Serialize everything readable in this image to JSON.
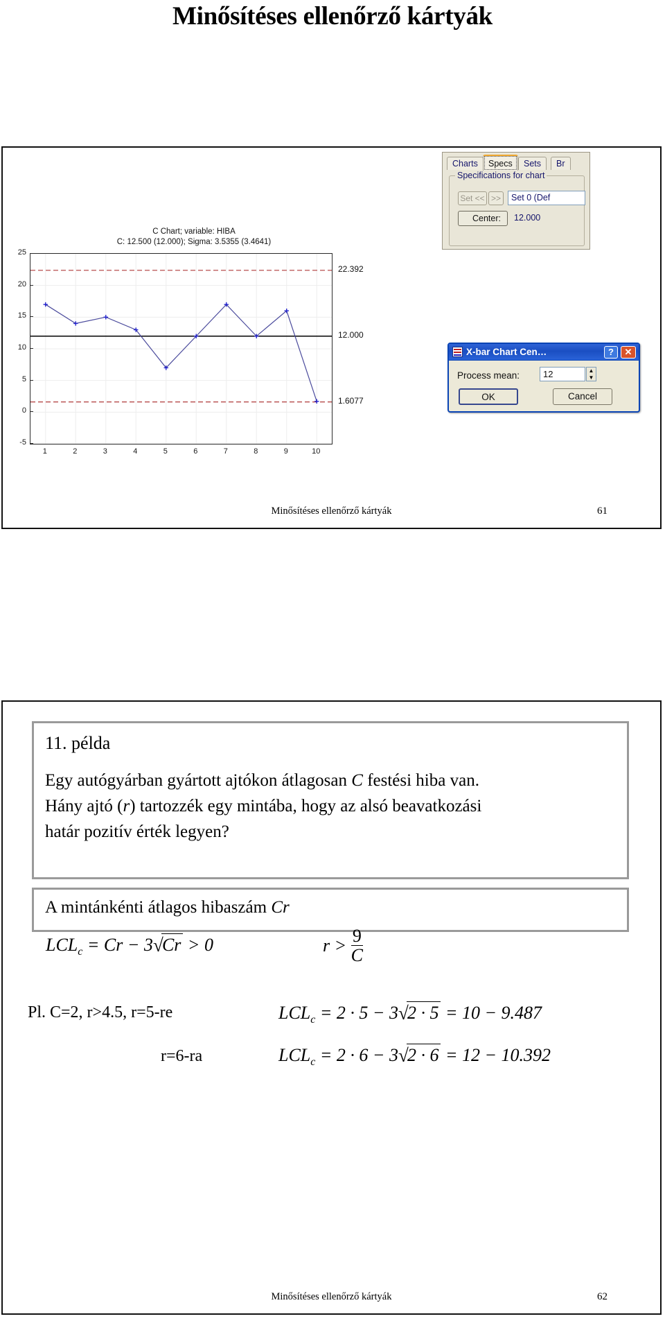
{
  "doc": {
    "title": "Minősítéses ellenőrző kártyák"
  },
  "slide61": {
    "footer_title": "Minősítéses ellenőrző kártyák",
    "page_number": "61",
    "chart": {
      "title": "C Chart; variable:  HIBA",
      "subtitle": "C: 12.500 (12.000); Sigma: 3.5355 (3.4641)",
      "ucl_label": "22.392",
      "cl_label": "12.000",
      "lcl_label": "1.6077"
    },
    "specs_panel": {
      "tabs": [
        "Charts",
        "Specs",
        "Sets",
        "Br"
      ],
      "active_tab": "Specs",
      "group_title": "Specifications for chart",
      "set_prev_label": "Set <<",
      "set_next_label": ">>",
      "set_combo_value": "Set 0 (Def",
      "center_button_label": "Center:",
      "center_icon": "center-arrow-icon",
      "center_value": "12.000"
    },
    "xbar_dialog": {
      "title": "X-bar Chart Cen…",
      "icon": "chart-window-icon",
      "help_label": "?",
      "close_label": "✕",
      "mean_label": "Process mean:",
      "mean_value": "12",
      "spin_up": "▲",
      "spin_down": "▼",
      "ok_label": "OK",
      "cancel_label": "Cancel"
    }
  },
  "slide62": {
    "footer_title": "Minősítéses ellenőrző kártyák",
    "page_number": "62",
    "example_heading": "11. példa",
    "example_line1_a": "Egy autógyárban gyártott ajtókon átlagosan ",
    "example_line1_c": "C",
    "example_line1_b": " festési hiba van.",
    "example_line2_a": "Hány ajtó (",
    "example_line2_r": "r",
    "example_line2_b": ") tartozzék egy mintába, hogy az alsó beavatkozási",
    "example_line3": "határ pozitív érték legyen?",
    "mean_text_a": "A mintánkénti átlagos hibaszám ",
    "mean_text_cr": "Cr",
    "formulas": {
      "lcl1_lhs": "LCL",
      "lcl1_sub": "c",
      "lcl1_mid": " = Cr − 3",
      "lcl1_radicand": "Cr",
      "lcl1_tail": " > 0",
      "r_gt": "r > ",
      "r_num": "9",
      "r_den": "C",
      "pl_label": "Pl. C=2, r>4.5, r=5-re",
      "lcl2_lhs": "LCL",
      "lcl2_sub": "c",
      "lcl2_mid": " = 2 · 5 − 3",
      "lcl2_radicand": "2 · 5",
      "lcl2_tail": " = 10 − 9.487",
      "r6_label": "r=6-ra",
      "lcl3_lhs": "LCL",
      "lcl3_sub": "c",
      "lcl3_mid": " = 2 · 6 − 3",
      "lcl3_radicand": "2 · 6",
      "lcl3_tail": " = 12 − 10.392"
    }
  },
  "chart_data": {
    "type": "line",
    "title": "C Chart; variable:  HIBA",
    "subtitle": "C: 12.500 (12.000); Sigma: 3.5355 (3.4641)",
    "xlabel": "",
    "ylabel": "",
    "x": [
      1,
      2,
      3,
      4,
      5,
      6,
      7,
      8,
      9,
      10
    ],
    "values": [
      17,
      14,
      15,
      13,
      7,
      12,
      17,
      12,
      16,
      1.7
    ],
    "xticks": [
      "1",
      "2",
      "3",
      "4",
      "5",
      "6",
      "7",
      "8",
      "9",
      "10"
    ],
    "yticks": [
      "-5",
      "0",
      "5",
      "10",
      "15",
      "20",
      "25"
    ],
    "ylim": [
      -5,
      25
    ],
    "xlim": [
      0.5,
      10.5
    ],
    "grid": true,
    "legend": null,
    "lines": [
      {
        "name": "UCL",
        "value": 22.392,
        "label": "22.392",
        "style": "dashed",
        "color": "#b03a3a"
      },
      {
        "name": "CL",
        "value": 12.0,
        "label": "12.000",
        "style": "solid",
        "color": "#000000"
      },
      {
        "name": "LCL",
        "value": 1.6077,
        "label": "1.6077",
        "style": "dashed",
        "color": "#b03a3a"
      }
    ],
    "series_color": "#4a4a9c",
    "marker": "plus",
    "marker_color": "#2222cc"
  }
}
